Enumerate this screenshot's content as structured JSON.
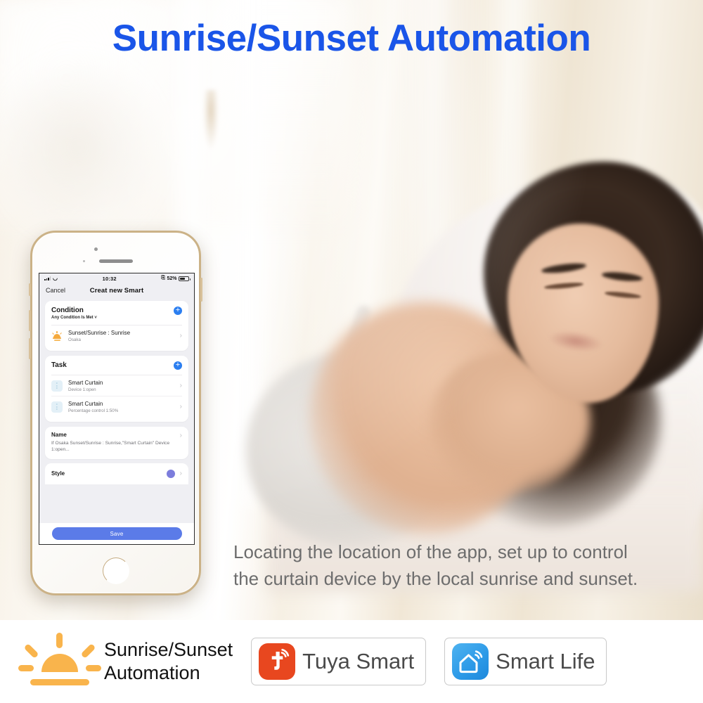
{
  "headline": "Sunrise/Sunset Automation",
  "caption": {
    "line1": "Locating the location of the app, set up to control",
    "line2": "the curtain device by the local sunrise and sunset."
  },
  "phone": {
    "status_bar": {
      "signal_icon": "cellular-signal-icon",
      "wifi_icon": "wifi-icon",
      "time": "10:32",
      "orientation_lock_icon": "rotation-lock-icon",
      "battery_percent": "52%",
      "battery_icon": "battery-icon"
    },
    "nav": {
      "cancel_label": "Cancel",
      "title": "Creat new Smart"
    },
    "condition_card": {
      "title": "Condition",
      "subtitle": "Any Condition Is Met ˅",
      "add_icon": "plus-circle-icon",
      "rows": [
        {
          "icon": "sunrise-icon",
          "title": "Sunset/Sunrise : Sunrise",
          "subtitle": "Osaka",
          "chevron": "›"
        }
      ]
    },
    "task_card": {
      "title": "Task",
      "add_icon": "plus-circle-icon",
      "rows": [
        {
          "icon": "curtain-device-icon",
          "title": "Smart Curtain",
          "subtitle": "Device 1:open",
          "chevron": "›"
        },
        {
          "icon": "curtain-device-icon",
          "title": "Smart Curtain",
          "subtitle": "Percentage control 1:50%",
          "chevron": "›"
        }
      ]
    },
    "name_card": {
      "title": "Name",
      "body": "If Osaka Sunset/Sunrise : Sunrise,\"Smart Curtain\" Device 1:open...",
      "chevron": "›"
    },
    "style_card": {
      "label": "Style",
      "swatch_color": "#7C7DDC",
      "chevron": "›"
    },
    "save_button": "Save"
  },
  "brand_bar": {
    "sun_icon": "sunrise-logo-icon",
    "product_name_line1": "Sunrise/Sunset",
    "product_name_line2": "Automation",
    "badges": [
      {
        "icon": "tuya-smart-logo-icon",
        "label": "Tuya Smart",
        "color": "#E8471F"
      },
      {
        "icon": "smart-life-logo-icon",
        "label": "Smart Life",
        "color": "#2E9BE8"
      }
    ]
  },
  "colors": {
    "headline_blue": "#1A55E8",
    "accent_blue": "#2B7EF0",
    "save_blue": "#5B7BE8",
    "sun_orange": "#F9B44C",
    "tuya_orange": "#E8471F",
    "smartlife_blue": "#2E9BE8"
  }
}
